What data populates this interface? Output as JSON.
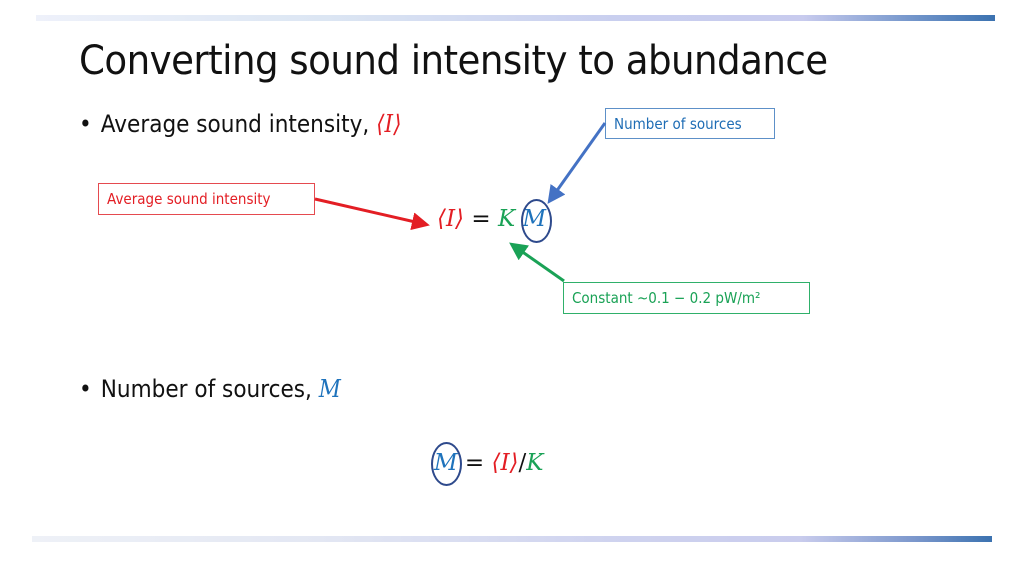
{
  "slide": {
    "title": "Converting sound intensity to abundance",
    "bullets": [
      {
        "text": "Average sound intensity, ",
        "symbol": "⟨I⟩"
      },
      {
        "text": "Number of sources, ",
        "symbol": "M"
      }
    ],
    "callouts": {
      "number_of_sources": "Number of sources",
      "average_sound_intensity": "Average sound intensity",
      "constant": "Constant ∼0.1 − 0.2 pW/m²"
    },
    "equation1": {
      "lhs": "⟨I⟩",
      "eq": " = ",
      "k": "K",
      "m": "M"
    },
    "equation2": {
      "m": "M",
      "eq": " = ",
      "i": "⟨I⟩",
      "slash": "/",
      "k": "K"
    },
    "colors": {
      "intensity": "#e31e24",
      "constant": "#1aa256",
      "sources": "#1f73bc",
      "ring": "#2e4a8c",
      "arrow_blue": "#4472c4"
    }
  }
}
